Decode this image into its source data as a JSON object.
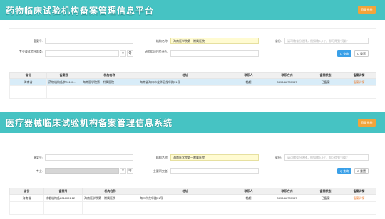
{
  "drug": {
    "title": "药物临床试验机构备案管理信息平台",
    "login": "登录系统",
    "labels": {
      "record_no": "备案号:",
      "org_name": "机构名称:",
      "area": "省份:",
      "specialty": "专业或试验所属类:",
      "researcher": "研究组项目负责人:"
    },
    "values": {
      "record_no": "",
      "org_name": "海南医学院第一附属医院",
      "area_placeholder": "请可输省份选择，例如输入\"hj\"，即可得到\"河北\"",
      "specialty": "",
      "researcher": ""
    },
    "buttons": {
      "query": "Q 查询",
      "reset": "C 重置",
      "clear": "×",
      "search": "Q"
    },
    "columns": [
      "省份",
      "备案号",
      "机构名称",
      "地址",
      "联系人",
      "联系方式",
      "备案状态",
      "备案详情"
    ],
    "rows": [
      [
        "海南省",
        "药物机构备字20190...",
        "海南医学院第一附属医院",
        "海南省海口市龙华区龙华路31号",
        "韩超",
        "0898-66737967",
        "已备案",
        "备案详情"
      ]
    ]
  },
  "device": {
    "title": "医疗器械临床试验机构备案管理信息系统",
    "login": "登录系统",
    "labels": {
      "record_no": "备案号:",
      "org_name": "机构名称:",
      "area": "省份:",
      "specialty": "专业:",
      "researcher": "主要研究者:"
    },
    "values": {
      "record_no": "",
      "org_name": "海南医学院第一附属医院",
      "area_placeholder": "请可输省份选择，例如输入\"hj\"，即可得到\"河北\"",
      "specialty": "",
      "researcher": ""
    },
    "buttons": {
      "query": "Q 查询",
      "reset": "C 重置",
      "clear": "×",
      "search": "Q"
    },
    "columns": [
      "省份",
      "备案号",
      "机构名称",
      "地址",
      "联系人",
      "联系方式",
      "备案状态",
      "备案详情"
    ],
    "rows": [
      [
        "海南省",
        "械临机构备2018001 22",
        "海南医学院第一附属医院",
        "海口市龙华路31号",
        "韩超",
        "0898-66737967",
        "已备案",
        "备案详情"
      ]
    ]
  }
}
